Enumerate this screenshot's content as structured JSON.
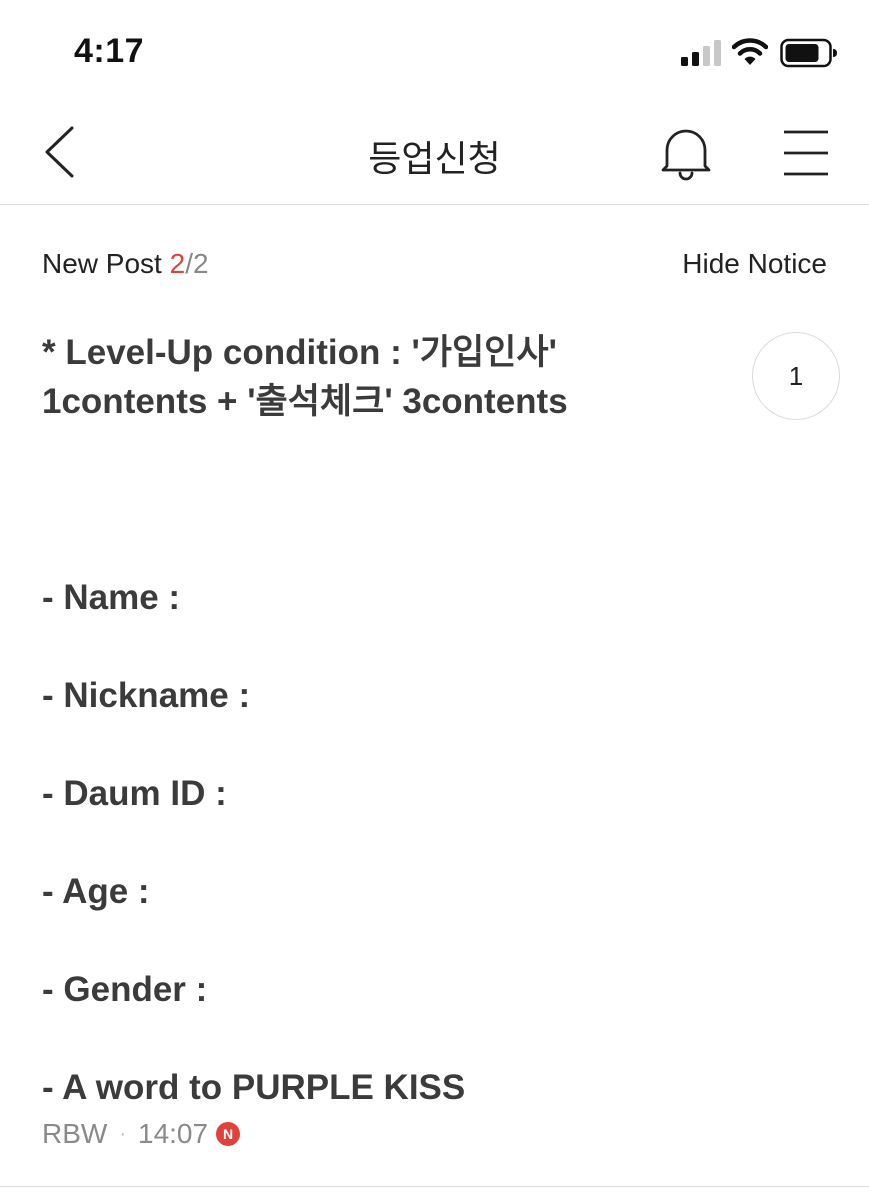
{
  "status_bar": {
    "time": "4:17",
    "icons": [
      "signal-icon",
      "wifi-icon",
      "battery-icon"
    ]
  },
  "header": {
    "title": "등업신청",
    "icons": [
      "back-icon",
      "bell-icon",
      "menu-icon"
    ]
  },
  "notice": {
    "label": "New Post",
    "current": "2",
    "separator": "/",
    "total": "2",
    "hide_label": "Hide Notice"
  },
  "post": {
    "title_line1": "* Level-Up condition : '가입인사'",
    "title_line2": "1contents + '출석체크' 3contents",
    "fields": [
      "- Name :",
      "- Nickname :",
      "- Daum ID :",
      "- Age :",
      "- Gender :",
      "- A word to PURPLE KISS"
    ],
    "author": "RBW",
    "meta_separator": "·",
    "time": "14:07",
    "new_badge": "N",
    "comment_count": "1"
  },
  "colors": {
    "accent_red": "#e0413b",
    "text_dark": "#3b3b3b",
    "text_muted": "#8a8a8a",
    "divider": "#dcdcdc"
  }
}
